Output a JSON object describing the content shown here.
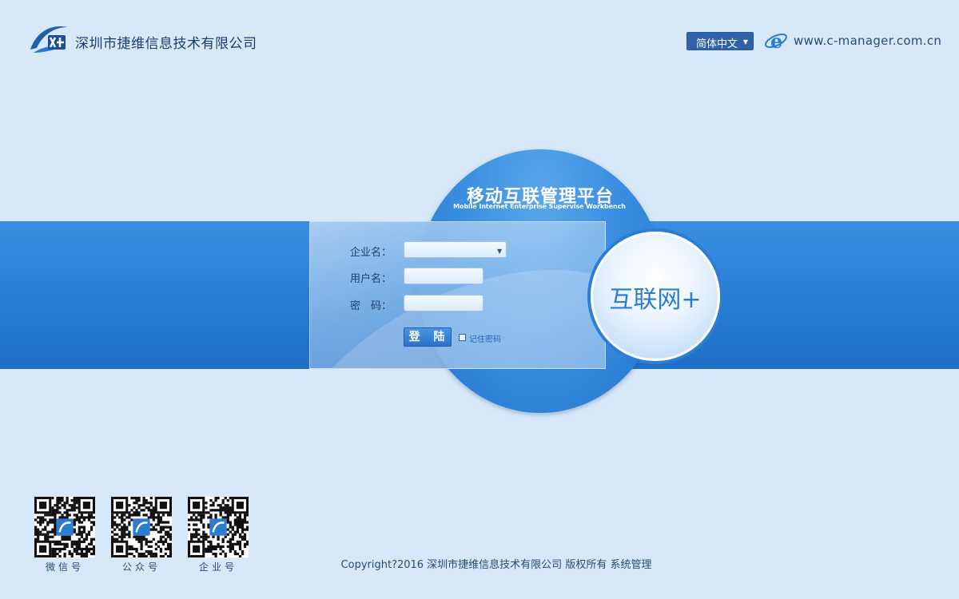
{
  "header": {
    "company_name": "深圳市捷维信息技术有限公司",
    "language": "简体中文",
    "site_url": "www.c-manager.com.cn"
  },
  "platform": {
    "title": "移动互联管理平台",
    "subtitle": "Mobile Internet Enterprise Supervise Workbench"
  },
  "login": {
    "company_label": "企业名：",
    "company_value": "",
    "username_label": "用户名：",
    "username_value": "",
    "password_label": "密　码：",
    "password_value": "",
    "login_button": "登 陆",
    "remember_label": "记住密码"
  },
  "badge": {
    "text": "互联网+"
  },
  "qr_codes": [
    {
      "label": "微信号"
    },
    {
      "label": "公众号"
    },
    {
      "label": "企业号"
    }
  ],
  "footer": {
    "copyright": "Copyright?2016  深圳市捷维信息技术有限公司 版权所有  系统管理"
  },
  "colors": {
    "accent": "#2b7fd6",
    "background": "#d7e9f8",
    "brand_dark": "#1b3d6e"
  }
}
